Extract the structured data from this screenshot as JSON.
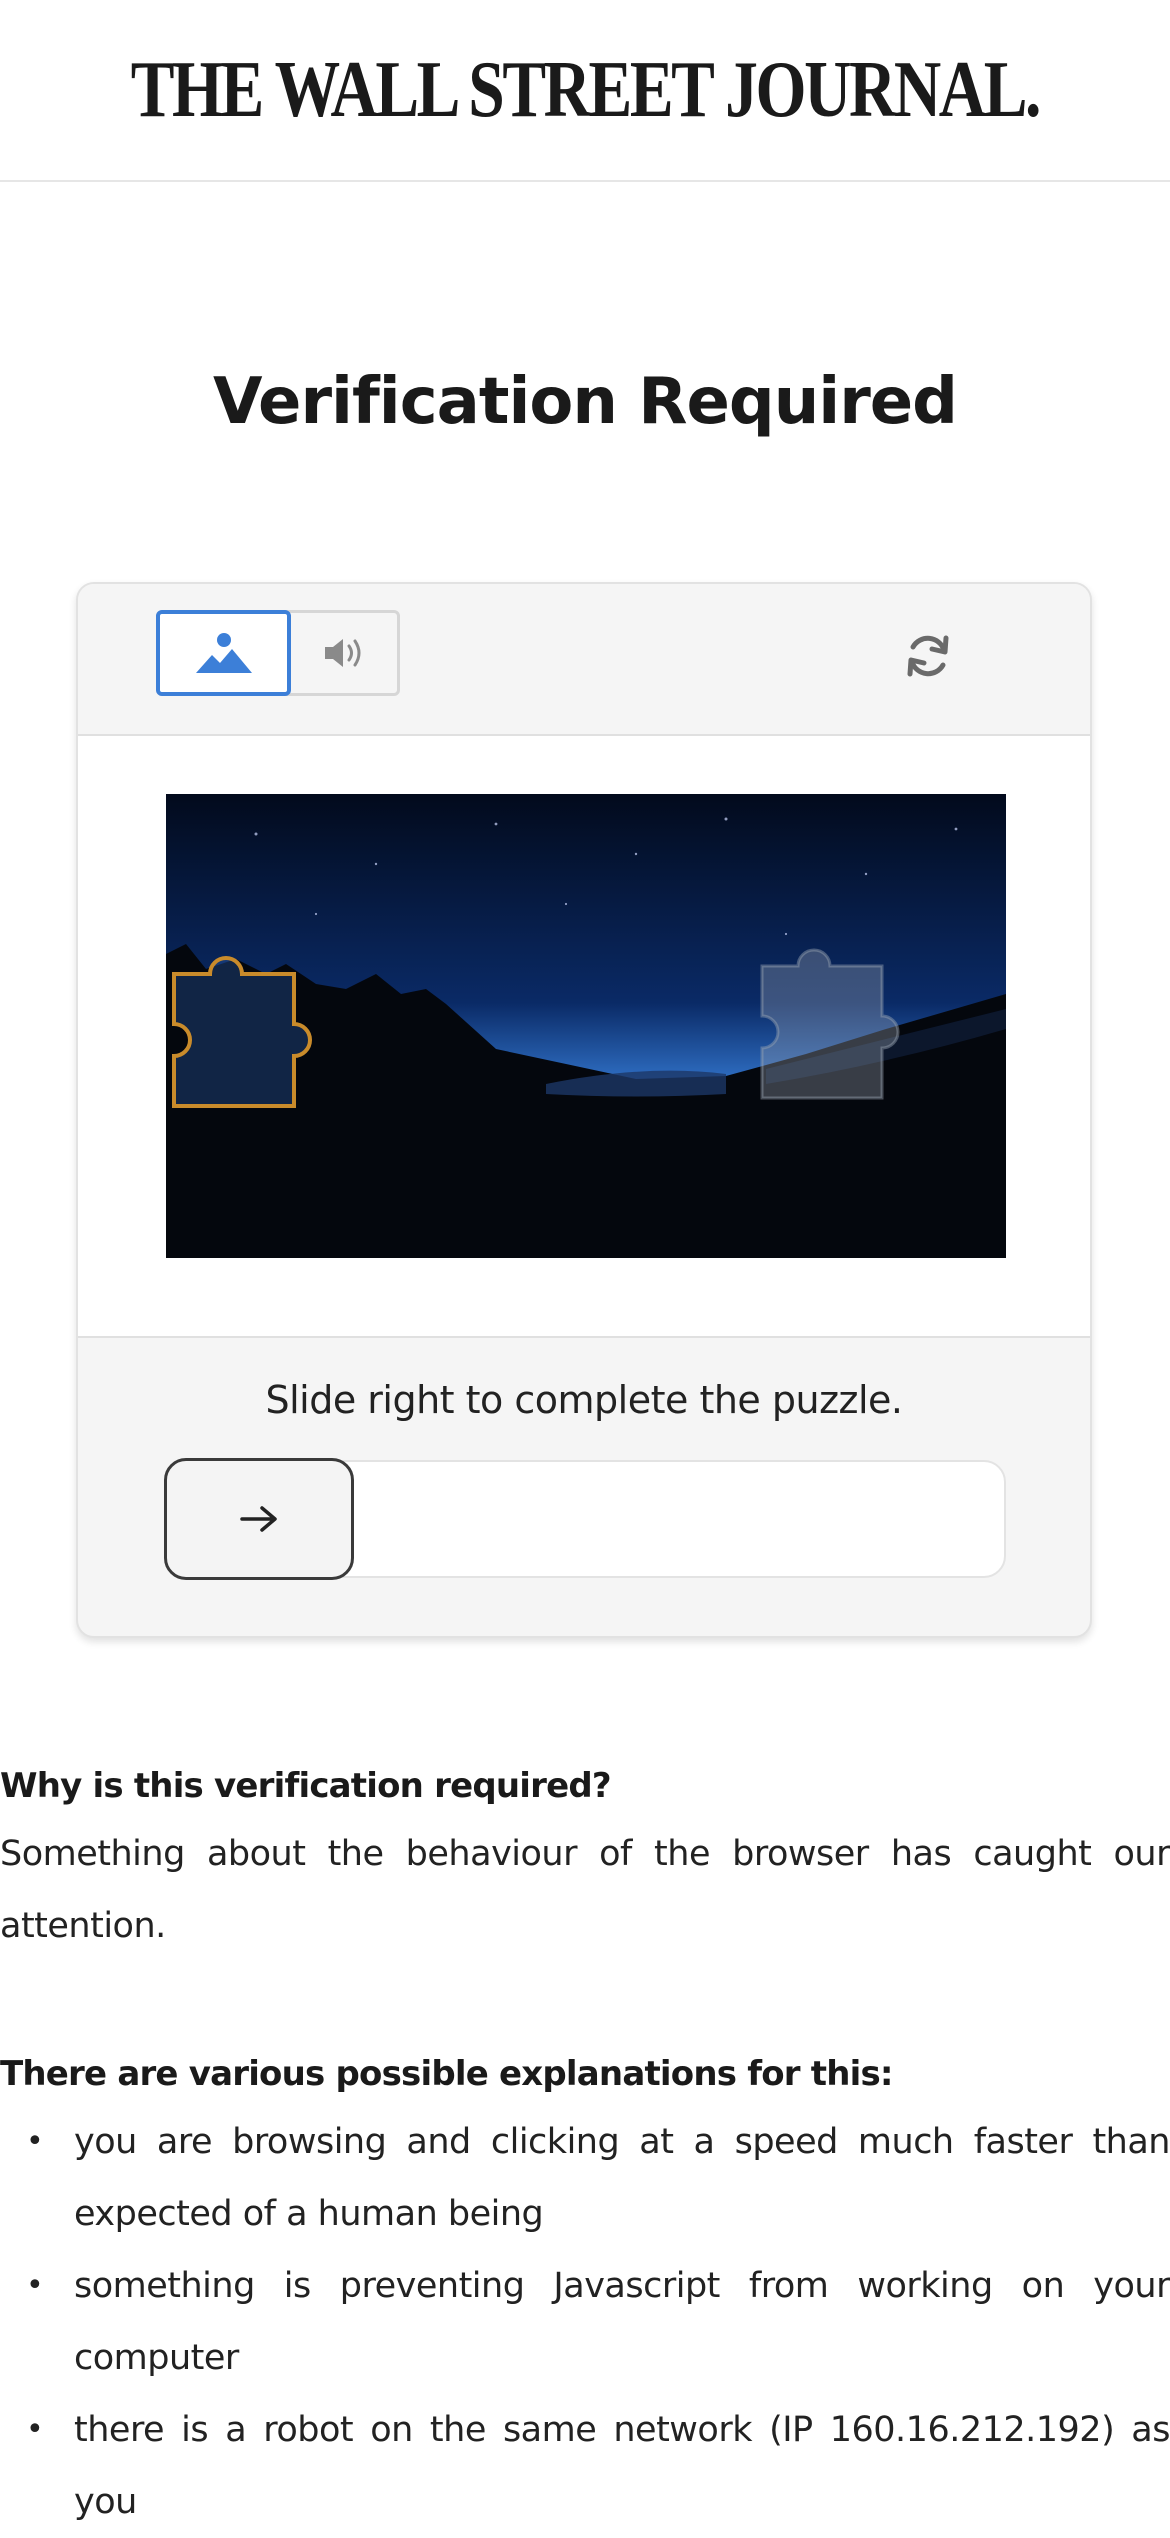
{
  "header": {
    "logo_text": "THE WALL STREET JOURNAL."
  },
  "page_title": "Verification Required",
  "captcha": {
    "mode_image_icon": "image-mountain-icon",
    "mode_audio_icon": "speaker-icon",
    "refresh_icon": "refresh-icon",
    "instruction": "Slide right to complete the puzzle.",
    "slider_icon": "arrow-right-icon",
    "accent_color": "#3c7fd8",
    "piece_outline_color": "#c98b2b"
  },
  "info": {
    "why_heading": "Why is this verification required?",
    "why_text": "Something about the behaviour of the browser has caught our attention.",
    "explanations_heading": "There are various possible explanations for this:",
    "explanations": [
      "you are browsing and clicking at a speed much faster than expected of a human being",
      "something is preventing Javascript from working on your computer",
      "there is a robot on the same network (IP 160.16.212.192) as you"
    ]
  }
}
